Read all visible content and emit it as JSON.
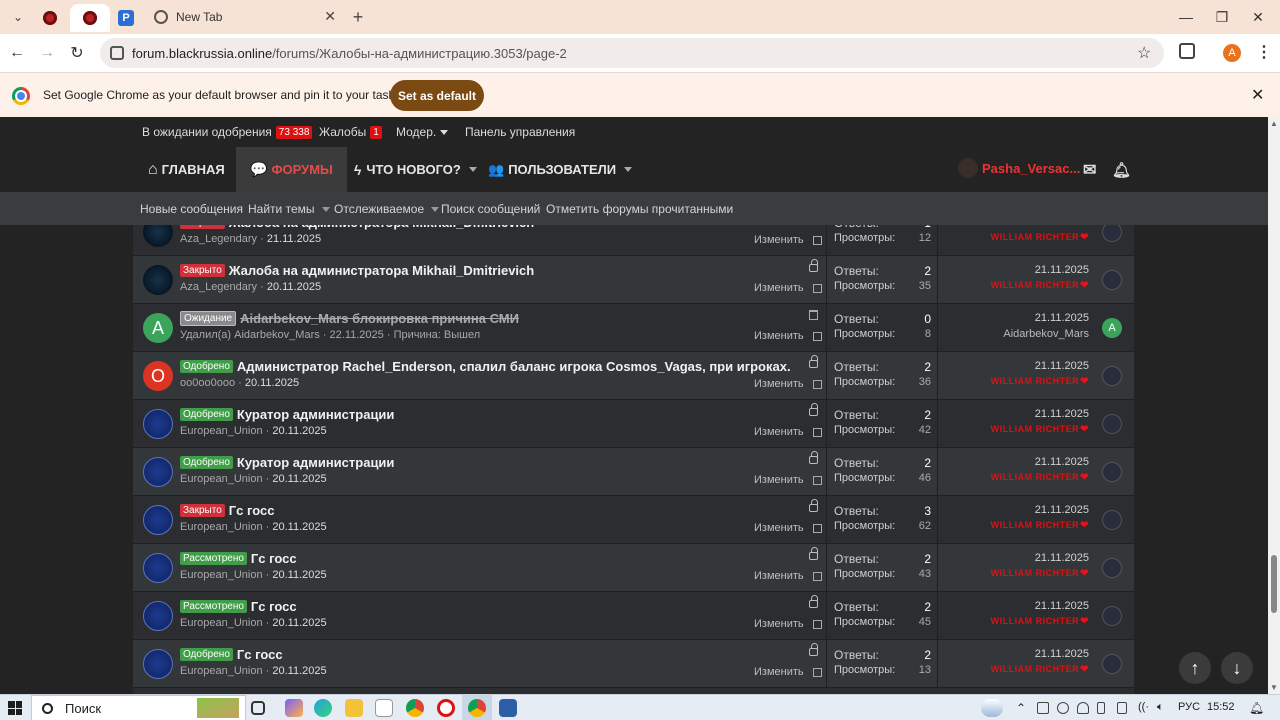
{
  "browser": {
    "new_tab_title": "New Tab",
    "url_domain": "forum.blackrussia.online",
    "url_path": "/forums/Жалобы-на-администрацию.3053/page-2",
    "profile_letter": "A",
    "infobar_message": "Set Google Chrome as your default browser and pin it to your taskbar",
    "infobar_button": "Set as default"
  },
  "forum": {
    "topline": {
      "pending_label": "В ожидании одобрения",
      "pending_count": "73 338",
      "complaints_label": "Жалобы",
      "complaints_count": "1",
      "moder_label": "Модер.",
      "panel_label": "Панель управления"
    },
    "nav": {
      "home": "ГЛАВНАЯ",
      "forums": "ФОРУМЫ",
      "whats_new": "ЧТО НОВОГО?",
      "users": "ПОЛЬЗОВАТЕЛИ",
      "username": "Pasha_Versac..."
    },
    "subnav": {
      "new_posts": "Новые сообщения",
      "find_threads": "Найти темы",
      "watched": "Отслеживаемое",
      "search": "Поиск сообщений",
      "mark_read": "Отметить форумы прочитанными"
    },
    "labels": {
      "replies": "Ответы:",
      "views": "Просмотры:",
      "edit": "Изменить"
    },
    "threads": [
      {
        "status": "Закрыто",
        "status_color": "red",
        "title": "Жалоба на администратора Mikhail_Dmitrievich",
        "author": "Aza_Legendary",
        "date": "21.11.2025",
        "replies": "1",
        "views": "12",
        "last_date": "21.11.2025",
        "last_user": "WILLIAM RICHTER",
        "avatar": "dark"
      },
      {
        "status": "Закрыто",
        "status_color": "red",
        "title": "Жалоба на администратора Mikhail_Dmitrievich",
        "author": "Aza_Legendary",
        "date": "20.11.2025",
        "replies": "2",
        "views": "35",
        "last_date": "21.11.2025",
        "last_user": "WILLIAM RICHTER",
        "avatar": "dark"
      },
      {
        "status": "Ожидание",
        "status_color": "grey",
        "title": "Aidarbekov_Mars блокировка причина СМИ",
        "author": "Удалил(а) Aidarbekov_Mars",
        "date": "22.11.2025",
        "reason": "Причина: Вышел",
        "replies": "0",
        "views": "8",
        "last_date": "21.11.2025",
        "last_user": "Aidarbekov_Mars",
        "avatar": "A",
        "deleted": true
      },
      {
        "status": "Одобрено",
        "status_color": "green",
        "title": "Администратор Rachel_Enderson, спалил баланс игрока Cosmos_Vagas, при игроках.",
        "author": "oo0oo0ooo",
        "date": "20.11.2025",
        "replies": "2",
        "views": "36",
        "last_date": "21.11.2025",
        "last_user": "WILLIAM RICHTER",
        "avatar": "O"
      },
      {
        "status": "Одобрено",
        "status_color": "green",
        "title": "Куратор администрации",
        "author": "European_Union",
        "date": "20.11.2025",
        "replies": "2",
        "views": "42",
        "last_date": "21.11.2025",
        "last_user": "WILLIAM RICHTER",
        "avatar": "eu"
      },
      {
        "status": "Одобрено",
        "status_color": "green",
        "title": "Куратор администрации",
        "author": "European_Union",
        "date": "20.11.2025",
        "replies": "2",
        "views": "46",
        "last_date": "21.11.2025",
        "last_user": "WILLIAM RICHTER",
        "avatar": "eu"
      },
      {
        "status": "Закрыто",
        "status_color": "red",
        "title": "Гс госс",
        "author": "European_Union",
        "date": "20.11.2025",
        "replies": "3",
        "views": "62",
        "last_date": "21.11.2025",
        "last_user": "WILLIAM RICHTER",
        "avatar": "eu"
      },
      {
        "status": "Рассмотрено",
        "status_color": "green",
        "title": "Гс госс",
        "author": "European_Union",
        "date": "20.11.2025",
        "replies": "2",
        "views": "43",
        "last_date": "21.11.2025",
        "last_user": "WILLIAM RICHTER",
        "avatar": "eu"
      },
      {
        "status": "Рассмотрено",
        "status_color": "green",
        "title": "Гс госс",
        "author": "European_Union",
        "date": "20.11.2025",
        "replies": "2",
        "views": "45",
        "last_date": "21.11.2025",
        "last_user": "WILLIAM RICHTER",
        "avatar": "eu"
      },
      {
        "status": "Одобрено",
        "status_color": "green",
        "title": "Гс госс",
        "author": "European_Union",
        "date": "20.11.2025",
        "replies": "2",
        "views": "13",
        "last_date": "21.11.2025",
        "last_user": "WILLIAM RICHTER",
        "avatar": "eu"
      }
    ]
  },
  "taskbar": {
    "search_placeholder": "Поиск",
    "lang": "РУС",
    "time": "15:52"
  },
  "colors": {
    "accent_red": "#e64b4b",
    "status_red": "#d0303a",
    "status_green": "#3f9e47",
    "status_grey": "#8a8a8a"
  }
}
